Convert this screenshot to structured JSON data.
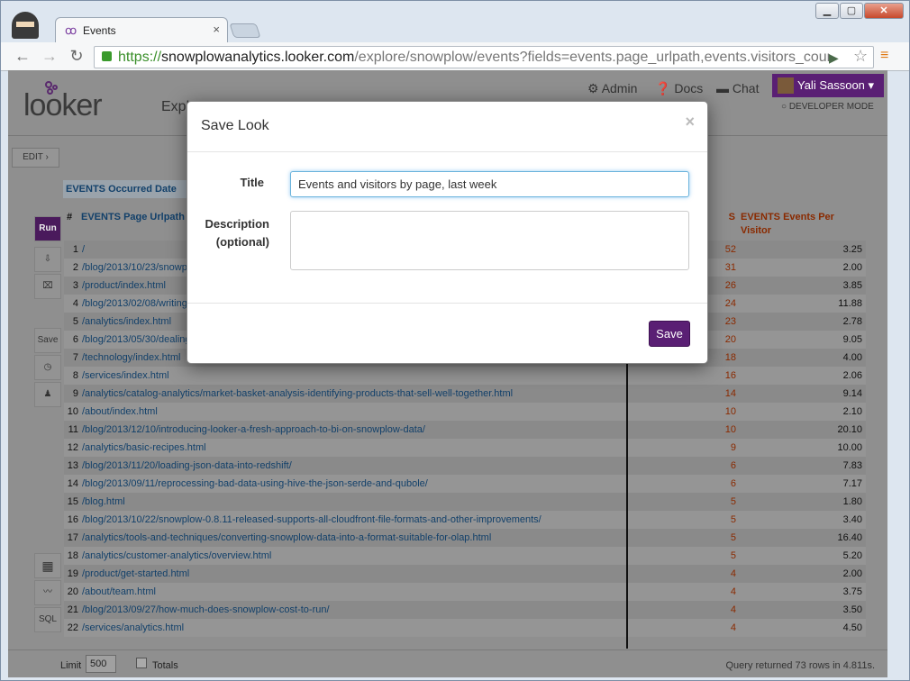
{
  "browser": {
    "tab_title": "Events",
    "url_scheme": "https://",
    "url_host": "snowplowanalytics.looker.com",
    "url_path": "/explore/snowplow/events?fields=events.page_urlpath,events.visitors_count"
  },
  "app": {
    "logo": "looker",
    "explore_label": "Explo",
    "admin_label": "Admin",
    "docs_label": "Docs",
    "chat_label": "Chat",
    "user_name": "Yali Sassoon",
    "developer_mode_label": "DEVELOPER MODE",
    "edit_label": "EDIT",
    "date_filter_label": "EVENTS Occurred Date",
    "run_label": "Run",
    "save_label": "Save",
    "sql_label": "SQL"
  },
  "grid": {
    "headers": {
      "num": "#",
      "url": "EVENTS Page Urlpath",
      "events": "S",
      "epv": "EVENTS Events Per Visitor"
    },
    "rows": [
      {
        "n": "1",
        "url": "/",
        "ev": "52",
        "epv": "3.25"
      },
      {
        "n": "2",
        "url": "/blog/2013/10/23/snowp",
        "ev": "31",
        "epv": "2.00"
      },
      {
        "n": "3",
        "url": "/product/index.html",
        "ev": "26",
        "epv": "3.85"
      },
      {
        "n": "4",
        "url": "/blog/2013/02/08/writing",
        "ev": "24",
        "epv": "11.88"
      },
      {
        "n": "5",
        "url": "/analytics/index.html",
        "ev": "23",
        "epv": "2.78"
      },
      {
        "n": "6",
        "url": "/blog/2013/05/30/dealing",
        "ev": "20",
        "epv": "9.05"
      },
      {
        "n": "7",
        "url": "/technology/index.html",
        "ev": "18",
        "epv": "4.00"
      },
      {
        "n": "8",
        "url": "/services/index.html",
        "ev": "16",
        "epv": "2.06"
      },
      {
        "n": "9",
        "url": "/analytics/catalog-analytics/market-basket-analysis-identifying-products-that-sell-well-together.html",
        "ev": "14",
        "epv": "9.14"
      },
      {
        "n": "10",
        "url": "/about/index.html",
        "ev": "10",
        "epv": "2.10"
      },
      {
        "n": "11",
        "url": "/blog/2013/12/10/introducing-looker-a-fresh-approach-to-bi-on-snowplow-data/",
        "ev": "10",
        "epv": "20.10"
      },
      {
        "n": "12",
        "url": "/analytics/basic-recipes.html",
        "ev": "9",
        "epv": "10.00"
      },
      {
        "n": "13",
        "url": "/blog/2013/11/20/loading-json-data-into-redshift/",
        "ev": "6",
        "epv": "7.83"
      },
      {
        "n": "14",
        "url": "/blog/2013/09/11/reprocessing-bad-data-using-hive-the-json-serde-and-qubole/",
        "ev": "6",
        "epv": "7.17"
      },
      {
        "n": "15",
        "url": "/blog.html",
        "ev": "5",
        "epv": "1.80"
      },
      {
        "n": "16",
        "url": "/blog/2013/10/22/snowplow-0.8.11-released-supports-all-cloudfront-file-formats-and-other-improvements/",
        "ev": "5",
        "epv": "3.40"
      },
      {
        "n": "17",
        "url": "/analytics/tools-and-techniques/converting-snowplow-data-into-a-format-suitable-for-olap.html",
        "ev": "5",
        "epv": "16.40"
      },
      {
        "n": "18",
        "url": "/analytics/customer-analytics/overview.html",
        "ev": "5",
        "epv": "5.20"
      },
      {
        "n": "19",
        "url": "/product/get-started.html",
        "ev": "4",
        "epv": "2.00"
      },
      {
        "n": "20",
        "url": "/about/team.html",
        "ev": "4",
        "epv": "3.75"
      },
      {
        "n": "21",
        "url": "/blog/2013/09/27/how-much-does-snowplow-cost-to-run/",
        "ev": "4",
        "epv": "3.50"
      },
      {
        "n": "22",
        "url": "/services/analytics.html",
        "ev": "4",
        "epv": "4.50"
      }
    ]
  },
  "footer": {
    "limit_label": "Limit",
    "limit_value": "500",
    "totals_label": "Totals",
    "query_info": "Query returned 73 rows in 4.811s."
  },
  "modal": {
    "title": "Save Look",
    "close_glyph": "×",
    "title_label": "Title",
    "title_value": "Events and visitors by page, last week",
    "description_label_1": "Description",
    "description_label_2": "(optional)",
    "description_value": "",
    "save_button": "Save"
  },
  "colors": {
    "accent": "#5a1f74",
    "link": "#12406a",
    "events": "#8a2a00"
  }
}
